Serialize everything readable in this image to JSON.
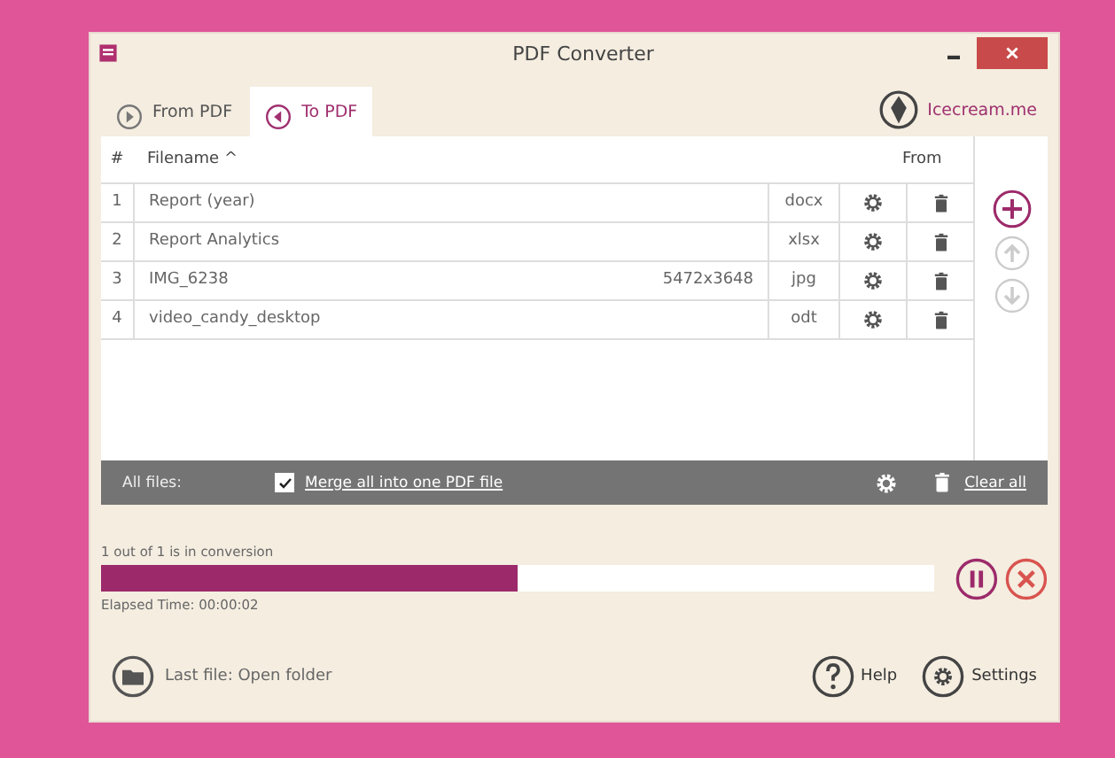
{
  "window": {
    "title": "PDF Converter"
  },
  "tabs": [
    {
      "label": "From PDF",
      "selected": false
    },
    {
      "label": "To PDF",
      "selected": true
    }
  ],
  "brand_link": "Icecream.me",
  "table": {
    "columns": [
      "#",
      "Filename ^",
      "",
      "From"
    ],
    "rows": [
      {
        "index": "1",
        "filename": "Report (year)",
        "size": "",
        "from": "docx"
      },
      {
        "index": "2",
        "filename": "Report Analytics",
        "size": "",
        "from": "xlsx"
      },
      {
        "index": "3",
        "filename": "IMG_6238",
        "size": "5472x3648",
        "from": "jpg"
      },
      {
        "index": "4",
        "filename": "video_candy_desktop",
        "size": "",
        "from": "odt"
      }
    ]
  },
  "footer": {
    "label": "All files:",
    "merge": {
      "label": "Merge all into one PDF file",
      "checked": true
    },
    "clear": "Clear all"
  },
  "progress": {
    "status": "1 out of 1 is in conversion",
    "level": 0.5,
    "elapsed": "Elapsed Time: 00:00:02"
  },
  "bottom": {
    "last_file": "Last file: Open folder",
    "help": "Help",
    "settings": "Settings"
  }
}
